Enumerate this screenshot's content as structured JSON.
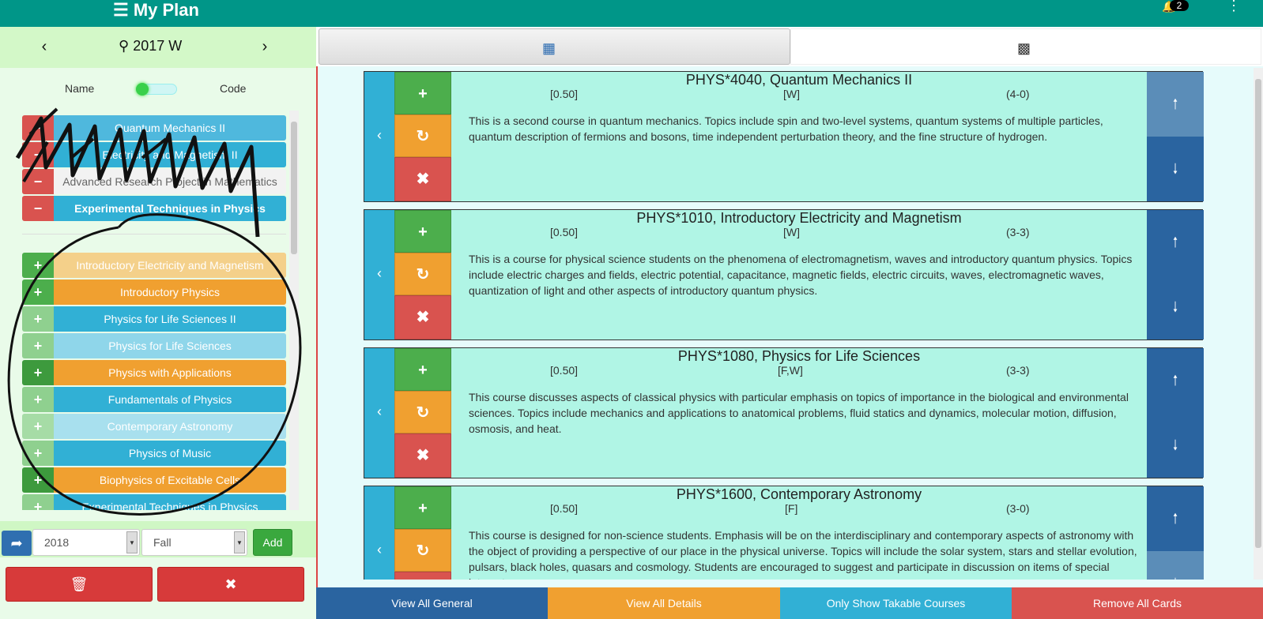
{
  "app": {
    "title": "☰ My Plan",
    "notification_count": "2"
  },
  "term": {
    "label": "2017 W"
  },
  "toggle": {
    "left_label": "Name",
    "right_label": "Code"
  },
  "planned_courses": [
    {
      "label": "Quantum Mechanics II",
      "button": "−"
    },
    {
      "label": "Electricity and Magnetism II",
      "button": "−"
    },
    {
      "label": "Advanced Research Project in Mathematics",
      "button": "−"
    },
    {
      "label": "Experimental Techniques in Physics",
      "button": "−"
    }
  ],
  "available_courses": [
    {
      "label": "Introductory Electricity and Magnetism",
      "button": "+"
    },
    {
      "label": "Introductory Physics",
      "button": "+"
    },
    {
      "label": "Physics for Life Sciences II",
      "button": "+"
    },
    {
      "label": "Physics for Life Sciences",
      "button": "+"
    },
    {
      "label": "Physics with Applications",
      "button": "+"
    },
    {
      "label": "Fundamentals of Physics",
      "button": "+"
    },
    {
      "label": "Contemporary Astronomy",
      "button": "+"
    },
    {
      "label": "Physics of Music",
      "button": "+"
    },
    {
      "label": "Biophysics of Excitable Cells",
      "button": "+"
    },
    {
      "label": "Experimental Techniques in Physics",
      "button": "+"
    }
  ],
  "add_row": {
    "year": "2018",
    "semester": "Fall",
    "add_label": "Add"
  },
  "cards": [
    {
      "title": "PHYS*4040, Quantum Mechanics II",
      "credits": "[0.50]",
      "offered": "[W]",
      "hours": "(4-0)",
      "description": "This is a second course in quantum mechanics. Topics include spin and two-level systems, quantum systems of multiple particles, quantum description of fermions and bosons, time independent perturbation theory, and the fine structure of hydrogen."
    },
    {
      "title": "PHYS*1010, Introductory Electricity and Magnetism",
      "credits": "[0.50]",
      "offered": "[W]",
      "hours": "(3-3)",
      "description": "This is a course for physical science students on the phenomena of electromagnetism, waves and introductory quantum physics. Topics include electric charges and fields, electric potential, capacitance, magnetic fields, electric circuits, waves, electromagnetic waves, quantization of light and other aspects of introductory quantum physics."
    },
    {
      "title": "PHYS*1080, Physics for Life Sciences",
      "credits": "[0.50]",
      "offered": "[F,W]",
      "hours": "(3-3)",
      "description": "This course discusses aspects of classical physics with particular emphasis on topics of importance in the biological and environmental sciences. Topics include mechanics and applications to anatomical problems, fluid statics and dynamics, molecular motion, diffusion, osmosis, and heat."
    },
    {
      "title": "PHYS*1600, Contemporary Astronomy",
      "credits": "[0.50]",
      "offered": "[F]",
      "hours": "(3-0)",
      "description": "This course is designed for non-science students. Emphasis will be on the interdisciplinary and contemporary aspects of astronomy with the object of providing a perspective of our place in the physical universe. Topics will include the solar system, stars and stellar evolution, pulsars, black holes, quasars and cosmology. Students are encouraged to suggest and participate in discussion on items of special interest."
    }
  ],
  "bottom_buttons": {
    "view_general": "View All General",
    "view_details": "View All Details",
    "takable": "Only Show Takable Courses",
    "remove_all": "Remove All Cards"
  },
  "icons": {
    "menu": "hamburger-icon",
    "bell": "bell-icon",
    "kebab": "kebab-icon",
    "prev": "chevron-left-icon",
    "next": "chevron-right-icon",
    "search": "search-icon",
    "dashboard": "dashboard-icon",
    "chart": "bar-chart-icon",
    "share": "share-icon",
    "trash": "trash-icon",
    "trash-x": "trash-x-icon",
    "plus": "plus-icon",
    "refresh": "refresh-icon",
    "remove": "x-icon",
    "up": "arrow-up-icon",
    "down": "arrow-down-icon"
  },
  "colors": {
    "brand": "#009688",
    "green": "#4cae4c",
    "orange": "#f0a030",
    "blue": "#31b0d5",
    "red": "#d9534f",
    "darkblue": "#2a64a0"
  }
}
